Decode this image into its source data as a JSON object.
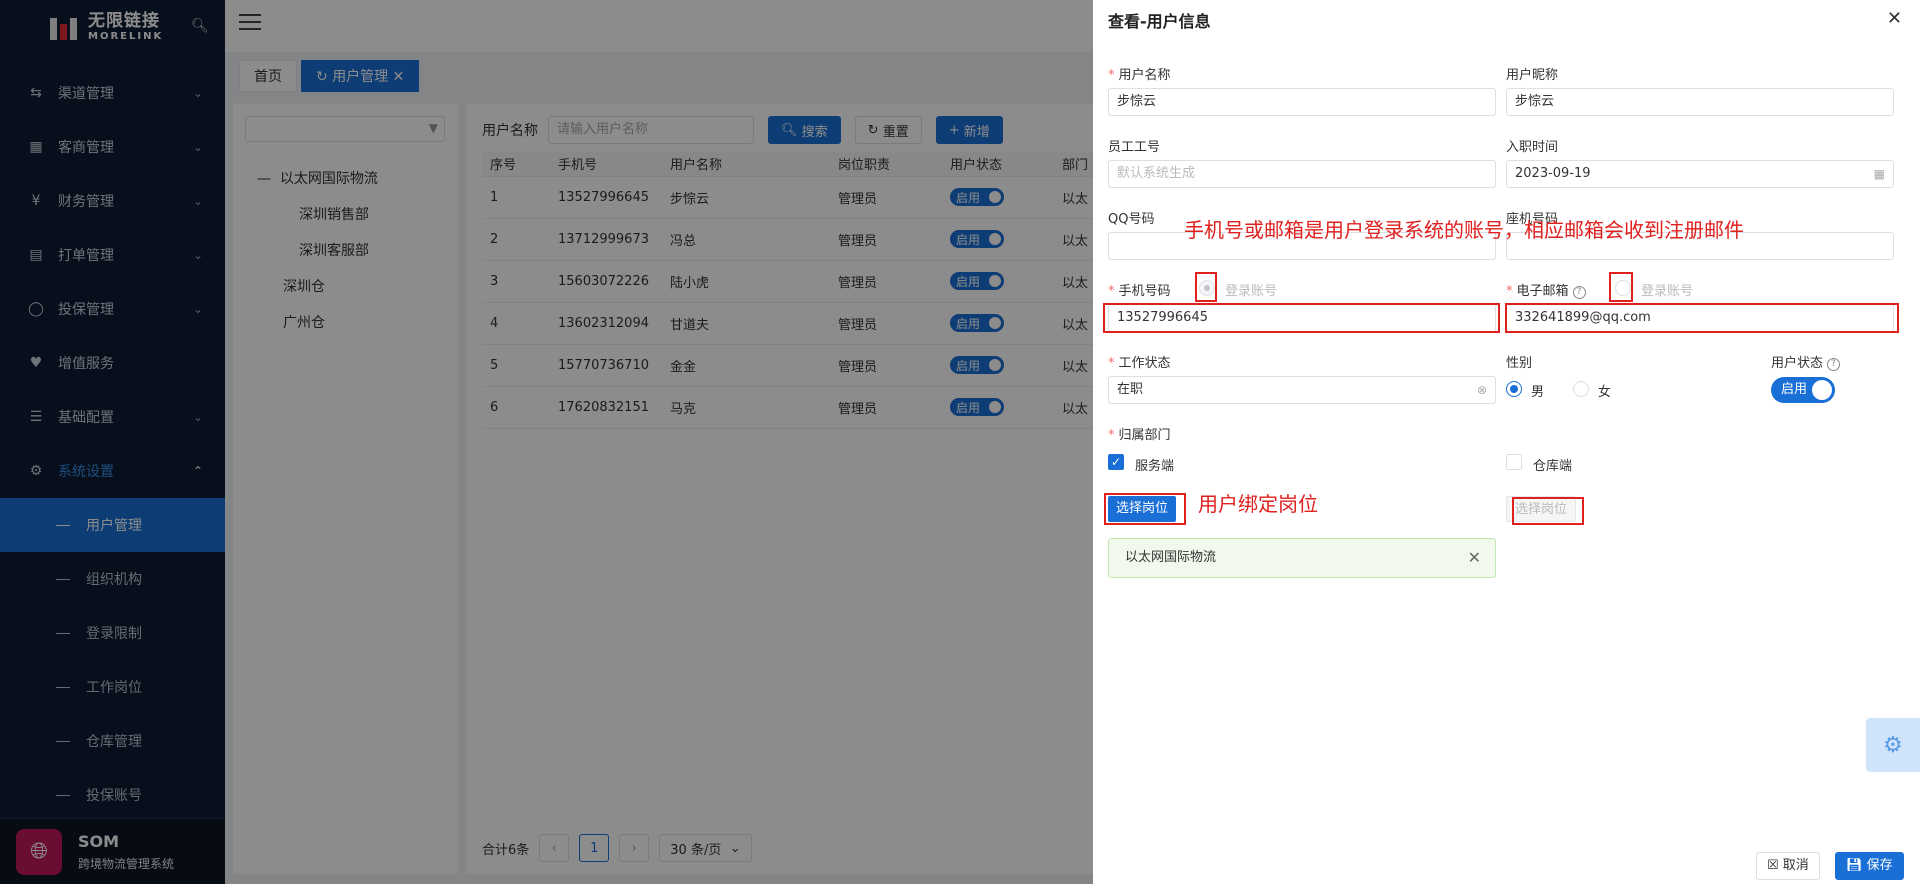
{
  "brand": {
    "name_cn": "无限链接",
    "name_en": "MORELINK"
  },
  "sidebar": {
    "menu": [
      {
        "label": "渠道管理",
        "icon": "channel-icon"
      },
      {
        "label": "客商管理",
        "icon": "merchant-icon"
      },
      {
        "label": "财务管理",
        "icon": "yen-icon"
      },
      {
        "label": "打单管理",
        "icon": "print-order-icon"
      },
      {
        "label": "投保管理",
        "icon": "shield-icon"
      },
      {
        "label": "增值服务",
        "icon": "heart-hand-icon"
      },
      {
        "label": "基础配置",
        "icon": "layers-icon"
      },
      {
        "label": "系统设置",
        "icon": "gear-icon"
      }
    ],
    "submenu": [
      "用户管理",
      "组织机构",
      "登录限制",
      "工作岗位",
      "仓库管理",
      "投保账号"
    ],
    "footer": {
      "name": "SOM",
      "desc": "跨境物流管理系统"
    }
  },
  "tabs": {
    "home": "首页",
    "active": "用户管理"
  },
  "tree": {
    "root": "以太网国际物流",
    "children": [
      "深圳销售部",
      "深圳客服部"
    ],
    "others": [
      "深圳仓",
      "广州仓"
    ]
  },
  "list": {
    "filter_label": "用户名称",
    "filter_placeholder": "请输入用户名称",
    "search_btn": "搜索",
    "reset_btn": "重置",
    "add_btn": "新增",
    "columns": [
      "序号",
      "手机号",
      "用户名称",
      "岗位职责",
      "用户状态",
      "部门"
    ],
    "rows": [
      [
        "1",
        "13527996645",
        "步悰云",
        "管理员",
        "启用",
        "以太"
      ],
      [
        "2",
        "13712999673",
        "冯总",
        "管理员",
        "启用",
        "以太"
      ],
      [
        "3",
        "15603072226",
        "陆小虎",
        "管理员",
        "启用",
        "以太"
      ],
      [
        "4",
        "13602312094",
        "甘道夫",
        "管理员",
        "启用",
        "以太"
      ],
      [
        "5",
        "15770736710",
        "金金",
        "管理员",
        "启用",
        "以太"
      ],
      [
        "6",
        "17620832151",
        "马克",
        "管理员",
        "启用",
        "以太"
      ]
    ],
    "total": "合计6条",
    "page": "1",
    "page_size": "30 条/页"
  },
  "drawer": {
    "title": "查看-用户信息",
    "username_label": "用户名称",
    "username": "步悰云",
    "nickname_label": "用户昵称",
    "nickname": "步悰云",
    "empno_label": "员工工号",
    "empno_placeholder": "默认系统生成",
    "hire_label": "入职时间",
    "hire_date": "2023-09-19",
    "qq_label": "QQ号码",
    "landline_label": "座机号码",
    "phone_label": "手机号码",
    "login_account": "登录账号",
    "phone": "13527996645",
    "email_label": "电子邮箱",
    "email": "332641899@qq.com",
    "work_status_label": "工作状态",
    "work_status": "在职",
    "gender_label": "性别",
    "gender_male": "男",
    "gender_female": "女",
    "user_status_label": "用户状态",
    "user_status": "启用",
    "dept_label": "归属部门",
    "dept_service": "服务端",
    "dept_warehouse": "仓库端",
    "choose_position": "选择岗位",
    "position_tag": "以太网国际物流",
    "cancel": "取消",
    "save": "保存"
  },
  "annotations": {
    "account_note": "手机号或邮箱是用户登录系统的账号，相应邮箱会收到注册邮件",
    "position_note": "用户绑定岗位"
  },
  "colors": {
    "primary": "#1a6fd6",
    "sidebar": "#0f1c33",
    "annotation": "#e0201e"
  }
}
